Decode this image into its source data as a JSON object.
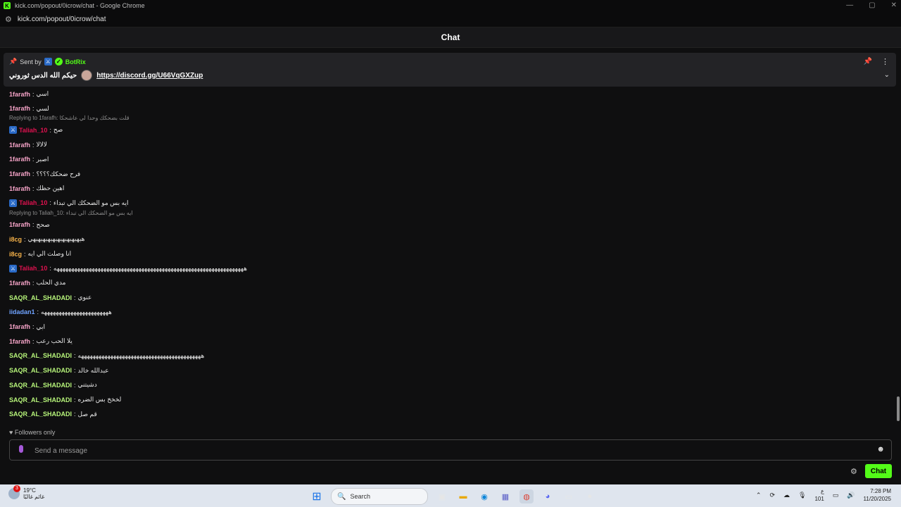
{
  "window": {
    "title": "kick.com/popout/0icrow/chat - Google Chrome",
    "url": "kick.com/popout/0icrow/chat"
  },
  "header": {
    "title": "Chat"
  },
  "pinned": {
    "sent_by_label": "Sent by",
    "sender": "BotRix",
    "message_text": "حيكم الله الدس ثوروني",
    "link": "https://discord.gg/U66VqGXZup"
  },
  "messages": [
    {
      "type": "msg",
      "user": "1farafh",
      "color": "#f5a3c7",
      "text": "اسي"
    },
    {
      "type": "msg",
      "user": "1farafh",
      "color": "#f5a3c7",
      "text": "لسي"
    },
    {
      "type": "reply",
      "text": "Replying to 1farafh: قلت بضحكك وحدا لي عاشحكا"
    },
    {
      "type": "msg",
      "user": "Taliah_10",
      "color": "#e0114f",
      "mod": true,
      "text": "صح"
    },
    {
      "type": "msg",
      "user": "1farafh",
      "color": "#f5a3c7",
      "text": "لالالا"
    },
    {
      "type": "msg",
      "user": "1farafh",
      "color": "#f5a3c7",
      "text": "اصبر"
    },
    {
      "type": "msg",
      "user": "1farafh",
      "color": "#f5a3c7",
      "text": "فرح ضحكك؟؟؟؟"
    },
    {
      "type": "msg",
      "user": "1farafh",
      "color": "#f5a3c7",
      "text": "اهين حظك"
    },
    {
      "type": "msg",
      "user": "Taliah_10",
      "color": "#e0114f",
      "mod": true,
      "text": "ايه بس مو الضحكك الي تبداء"
    },
    {
      "type": "reply",
      "text": "Replying to Taliah_10: ايه بس مو الضحكك الي تبداء"
    },
    {
      "type": "msg",
      "user": "1farafh",
      "color": "#f5a3c7",
      "text": "صحح"
    },
    {
      "type": "msg",
      "user": "i8cg",
      "color": "#f7b34a",
      "text": "هيهيهيهيهيهيهيهيهيهيهي"
    },
    {
      "type": "msg",
      "user": "i8cg",
      "color": "#f7b34a",
      "text": "انا وصلت الي ايه"
    },
    {
      "type": "msg",
      "user": "Taliah_10",
      "color": "#e0114f",
      "mod": true,
      "text": "هههههههههههههههههههههههههههههههههههههههههههههههههههههههههههههههههه"
    },
    {
      "type": "msg",
      "user": "1farafh",
      "color": "#f5a3c7",
      "text": "مدي الحلب"
    },
    {
      "type": "msg",
      "user": "SAQR_AL_SHADADI",
      "color": "#b7f57a",
      "text": "عنوي"
    },
    {
      "type": "msg",
      "user": "iidadan1",
      "color": "#6fa3ff",
      "text": "هههههههههههههههههههههههه"
    },
    {
      "type": "msg",
      "user": "1farafh",
      "color": "#f5a3c7",
      "text": "ابي"
    },
    {
      "type": "msg",
      "user": "1farafh",
      "color": "#f5a3c7",
      "text": "يلا الحب رعب"
    },
    {
      "type": "msg",
      "user": "SAQR_AL_SHADADI",
      "color": "#b7f57a",
      "text": "ههههههههههههههههههههههههههههههههههههههههههه"
    },
    {
      "type": "msg",
      "user": "SAQR_AL_SHADADI",
      "color": "#b7f57a",
      "text": "عبدالله خالد"
    },
    {
      "type": "msg",
      "user": "SAQR_AL_SHADADI",
      "color": "#b7f57a",
      "text": "دشيتني"
    },
    {
      "type": "msg",
      "user": "SAQR_AL_SHADADI",
      "color": "#b7f57a",
      "text": "لخخخ بس الضره"
    },
    {
      "type": "msg",
      "user": "SAQR_AL_SHADADI",
      "color": "#b7f57a",
      "text": "قم صل"
    }
  ],
  "footer": {
    "followers_only": "Followers only",
    "input_placeholder": "Send a message",
    "chat_button": "Chat"
  },
  "taskbar": {
    "temperature": "19°C",
    "weather_text": "غائم غالبًا",
    "weather_badge": "3",
    "search_label": "Search",
    "keyboard_lang": "ع",
    "keyboard_sub": "101",
    "time": "7:28 PM",
    "date": "11/20/2025"
  }
}
